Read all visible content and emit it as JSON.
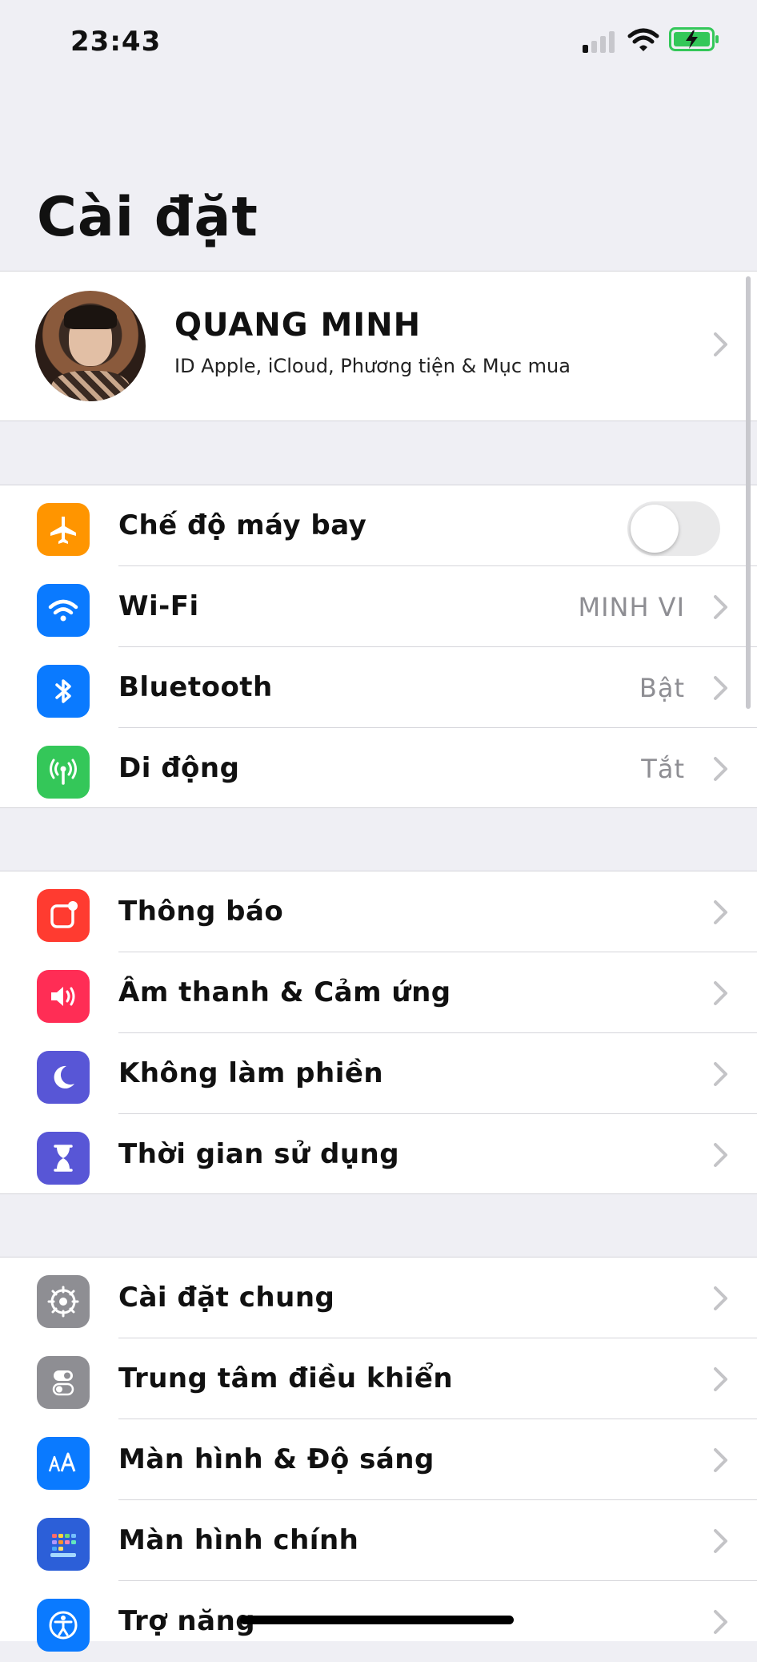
{
  "status_bar": {
    "time": "23:43"
  },
  "page_title": "Cài đặt",
  "profile": {
    "name": "QUANG MINH",
    "subtitle": "ID Apple, iCloud, Phương tiện & Mục mua"
  },
  "groups": [
    {
      "rows": [
        {
          "label": "Chế độ máy bay",
          "icon": "airplane-icon",
          "color": "#ff9500",
          "control": "toggle",
          "toggle_on": false
        },
        {
          "label": "Wi-Fi",
          "icon": "wifi-icon",
          "color": "#0a7aff",
          "value": "MINH VI"
        },
        {
          "label": "Bluetooth",
          "icon": "bluetooth-icon",
          "color": "#0a7aff",
          "value": "Bật"
        },
        {
          "label": "Di động",
          "icon": "cellular-icon",
          "color": "#34c759",
          "value": "Tắt"
        }
      ]
    },
    {
      "rows": [
        {
          "label": "Thông báo",
          "icon": "notifications-icon",
          "color": "#ff3b30"
        },
        {
          "label": "Âm thanh & Cảm ứng",
          "icon": "sound-icon",
          "color": "#ff2d55"
        },
        {
          "label": "Không làm phiền",
          "icon": "moon-icon",
          "color": "#5856d6"
        },
        {
          "label": "Thời gian sử dụng",
          "icon": "hourglass-icon",
          "color": "#5856d6"
        }
      ]
    },
    {
      "rows": [
        {
          "label": "Cài đặt chung",
          "icon": "gear-icon",
          "color": "#8e8e93"
        },
        {
          "label": "Trung tâm điều khiển",
          "icon": "control-center-icon",
          "color": "#8e8e93"
        },
        {
          "label": "Màn hình & Độ sáng",
          "icon": "display-brightness-icon",
          "color": "#0a7aff"
        },
        {
          "label": "Màn hình chính",
          "icon": "home-screen-icon",
          "color": "#2c5fd8"
        },
        {
          "label": "Trợ năng",
          "icon": "accessibility-icon",
          "color": "#0a7aff"
        }
      ]
    }
  ]
}
